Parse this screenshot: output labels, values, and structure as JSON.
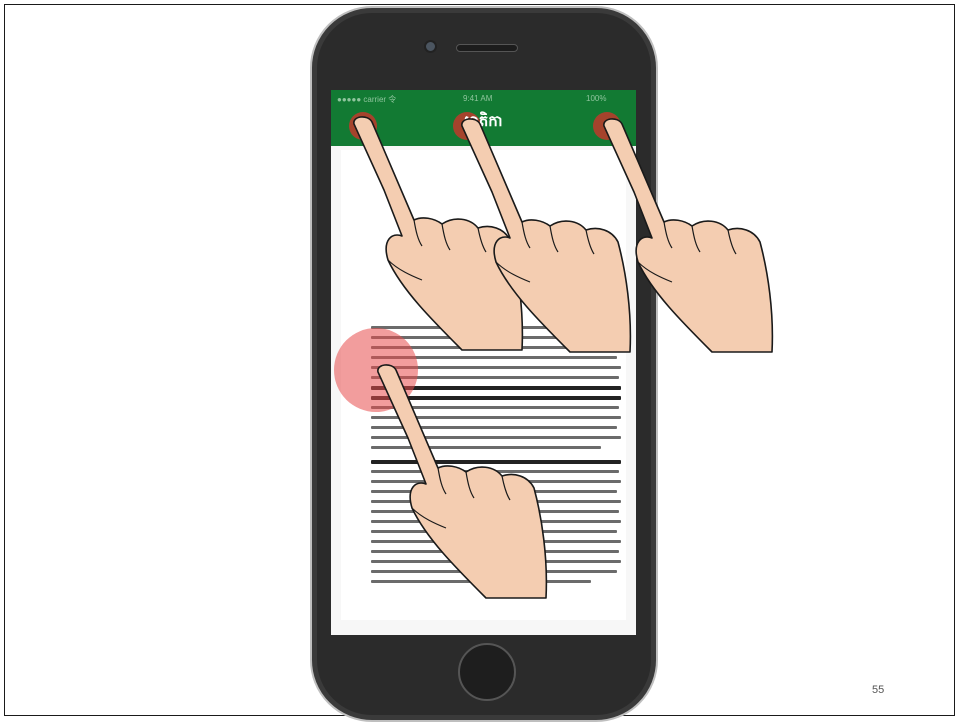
{
  "phone": {
    "status_carrier": "●●●●● carrier 令",
    "status_time": "9:41 AM",
    "status_battery": "100%",
    "app_title": "មាតិកា"
  },
  "slide": {
    "page_number": "55"
  },
  "colors": {
    "appbar": "#127a33",
    "tap_highlight": "#e74c4c",
    "button_highlight": "#c0392b"
  }
}
